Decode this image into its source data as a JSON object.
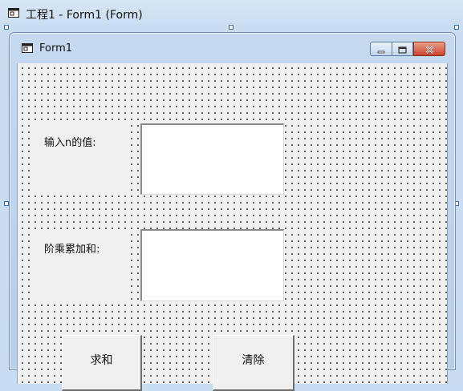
{
  "project_window": {
    "title": "工程1 - Form1 (Form)",
    "icon": "form-icon"
  },
  "form": {
    "title": "Form1",
    "icon": "form-icon",
    "controls": {
      "minimize_icon": "minimize-icon",
      "maximize_icon": "maximize-icon",
      "close_icon": "close-icon"
    }
  },
  "fields": {
    "label1": "输入n的值:",
    "text1": "",
    "label2": "阶乘累加和:",
    "text2": ""
  },
  "buttons": {
    "sum": "求和",
    "clear": "清除"
  }
}
